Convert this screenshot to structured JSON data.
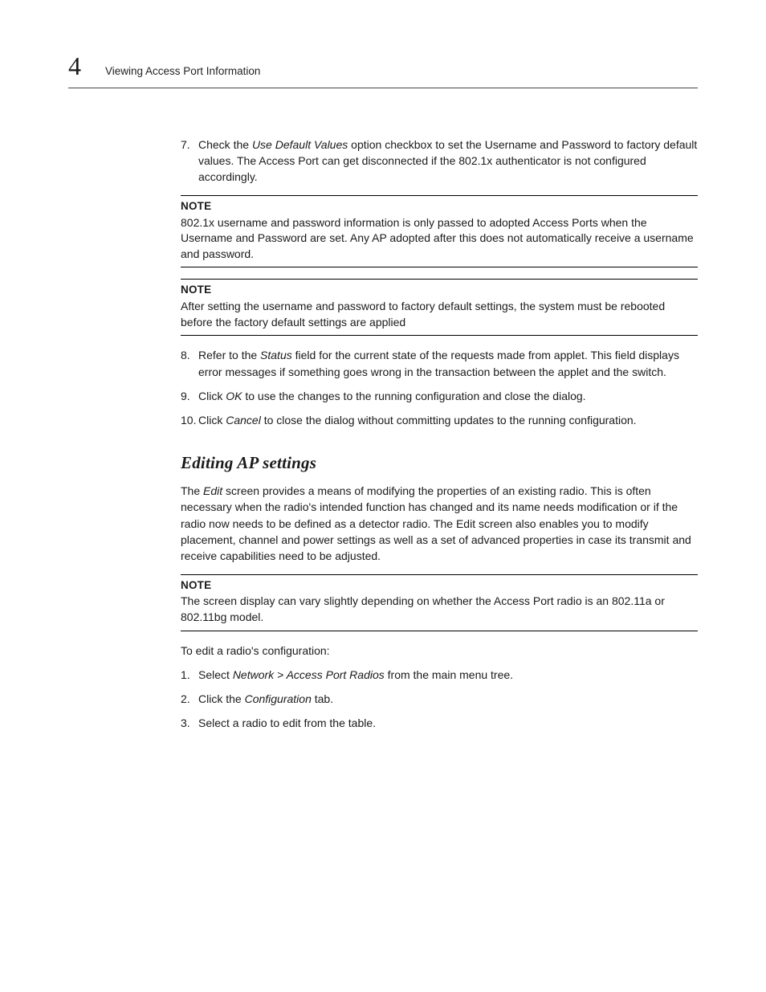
{
  "header": {
    "chapter_number": "4",
    "title": "Viewing Access Port Information"
  },
  "steps_first": [
    {
      "num": "7.",
      "prefix": "Check the ",
      "italic": "Use Default Values",
      "suffix": " option checkbox to set the Username and Password to factory default values. The Access Port can get disconnected if the 802.1x authenticator is not configured accordingly."
    }
  ],
  "note1": {
    "label": "NOTE",
    "text": "802.1x username and password information is only passed to adopted Access Ports when the Username and Password are set. Any AP adopted after this does not automatically receive a username and password."
  },
  "note2": {
    "label": "NOTE",
    "text": "After setting the username and password to factory default settings, the system must be rebooted before the factory default settings are applied"
  },
  "steps_second": [
    {
      "num": "8.",
      "prefix": "Refer to the ",
      "italic": "Status",
      "suffix": " field for the current state of the requests made from applet. This field displays error messages if something goes wrong in the transaction between the applet and the switch."
    },
    {
      "num": "9.",
      "prefix": "Click ",
      "italic": "OK",
      "suffix": " to use the changes to the running configuration and close the dialog."
    },
    {
      "num": "10.",
      "prefix": "Click ",
      "italic": "Cancel",
      "suffix": " to close the dialog without committing updates to the running configuration."
    }
  ],
  "section_heading": "Editing AP settings",
  "section_intro": {
    "prefix": "The ",
    "italic": "Edit",
    "suffix": " screen provides a means of modifying the properties of an existing radio. This is often necessary when the radio's intended function has changed and its name needs modification or if the radio now needs to be defined as a detector radio. The Edit screen also enables you to modify placement, channel and power settings as well as a set of advanced properties in case its transmit and receive capabilities need to be adjusted."
  },
  "note3": {
    "label": "NOTE",
    "text": "The screen display can vary slightly depending on whether the Access Port radio is an 802.11a or 802.11bg model."
  },
  "edit_intro": "To edit a radio's configuration:",
  "steps_third": [
    {
      "num": "1.",
      "prefix": "Select ",
      "italic": "Network > Access Port Radios",
      "suffix": " from the main menu tree."
    },
    {
      "num": "2.",
      "prefix": "Click the ",
      "italic": "Configuration",
      "suffix": " tab."
    },
    {
      "num": "3.",
      "prefix": "",
      "italic": "",
      "suffix": "Select a radio to edit from the table."
    }
  ]
}
